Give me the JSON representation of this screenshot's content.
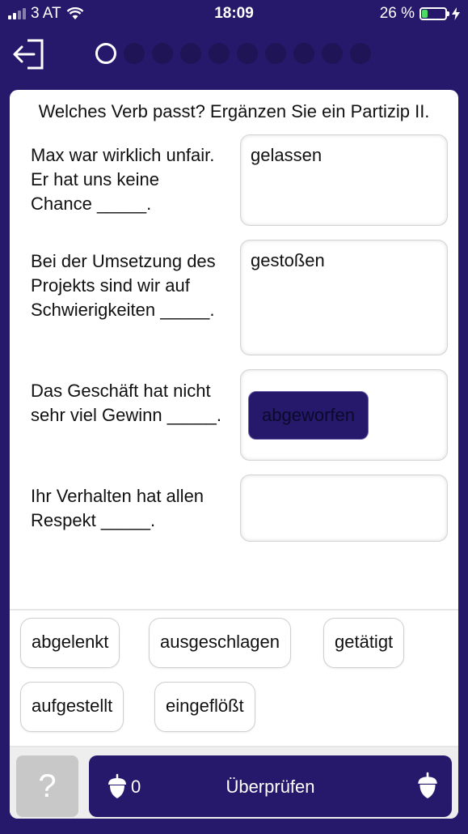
{
  "status_bar": {
    "carrier": "3 AT",
    "time": "18:09",
    "battery_percent": "26 %",
    "battery_level": 0.26
  },
  "header": {
    "progress": {
      "total": 10,
      "current": 1
    }
  },
  "exercise": {
    "instruction": "Welches Verb passt? Ergänzen Sie ein Partizip II.",
    "questions": [
      {
        "text": "Max war wirklich unfair. Er hat uns keine Chance _____.",
        "answer": "gelassen"
      },
      {
        "text": "Bei der Umsetzung des Projekts sind wir auf Schwierigkeiten _____.",
        "answer": "gestoßen"
      },
      {
        "text": "Das Geschäft hat nicht sehr viel Gewinn _____.",
        "answer": "abgeworfen"
      },
      {
        "text": "Ihr Verhalten hat allen Respekt _____.",
        "answer": ""
      }
    ]
  },
  "word_bank": [
    "abgelenkt",
    "ausgeschlagen",
    "getätigt",
    "aufgestellt",
    "eingeflößt"
  ],
  "footer": {
    "help_label": "?",
    "acorn_count": "0",
    "check_label": "Überprüfen"
  },
  "colors": {
    "brand": "#26196b",
    "battery_fill": "#4cd964"
  }
}
